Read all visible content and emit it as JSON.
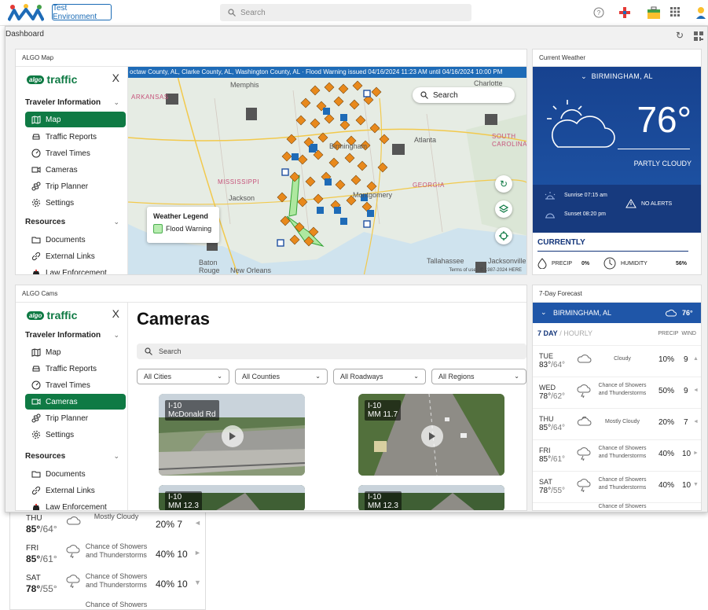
{
  "topbar": {
    "env_label": "Test Environment",
    "search_placeholder": "Search"
  },
  "dashboard": {
    "title": "Dashboard"
  },
  "sidebar": {
    "logo_badge": "algo",
    "logo_word": "traffic",
    "close": "X",
    "traveler_heading": "Traveler Information",
    "resources_heading": "Resources",
    "items": [
      {
        "label": "Map"
      },
      {
        "label": "Traffic Reports"
      },
      {
        "label": "Travel Times"
      },
      {
        "label": "Cameras"
      },
      {
        "label": "Trip Planner"
      },
      {
        "label": "Settings"
      }
    ],
    "resources": [
      {
        "label": "Documents"
      },
      {
        "label": "External Links"
      },
      {
        "label": "Law Enforcement"
      }
    ]
  },
  "map_card": {
    "title": "ALGO Map",
    "banner": "octaw County, AL, Clarke County, AL, Washington County, AL · Flood Warning issued 04/16/2024 11:23 AM until 04/16/2024 10:00 PM",
    "search_label": "Search",
    "labels": [
      "Memphis",
      "Charlotte",
      "ARKANSAS",
      "Atlanta",
      "SOUTH CAROLINA",
      "Birmingham",
      "MISSISSIPPI",
      "Jackson",
      "GEORGIA",
      "Montgomery",
      "Tallahassee",
      "Baton Rouge",
      "New Orleans",
      "Jacksonville"
    ],
    "legend_title": "Weather Legend",
    "legend_item": "Flood Warning",
    "terms": "Terms of use",
    "copyright": "© 1987-2024 HERE"
  },
  "weather_card": {
    "title": "Current Weather",
    "city": "BIRMINGHAM, AL",
    "temp": "76°",
    "condition": "PARTLY CLOUDY",
    "sunrise": "Sunrise 07:15 am",
    "sunset": "Sunset 08:20 pm",
    "alerts": "NO ALERTS",
    "currently": "CURRENTLY",
    "precip_label": "PRECIP",
    "precip_value": "0%",
    "humidity_label": "HUMIDITY",
    "humidity_value": "56%"
  },
  "cams_card": {
    "title": "ALGO Cams",
    "heading": "Cameras",
    "search_placeholder": "Search",
    "filters": [
      "All Cities",
      "All Counties",
      "All Roadways",
      "All Regions"
    ],
    "cams": [
      {
        "road": "I-10",
        "loc": "McDonald Rd"
      },
      {
        "road": "I-10",
        "loc": "MM 11.7"
      },
      {
        "road": "I-10",
        "loc": "MM 12.3"
      },
      {
        "road": "I-10",
        "loc": "MM 12.3"
      }
    ]
  },
  "forecast_card": {
    "title": "7-Day Forecast",
    "city": "BIRMINGHAM, AL",
    "temp": "76°",
    "tab_active": "7 DAY",
    "tab_sep": " / ",
    "tab_inactive": "HOURLY",
    "col_precip": "PRECIP",
    "col_wind": "WIND",
    "days": [
      {
        "day": "TUE",
        "hi": "83°",
        "lo": "/64°",
        "cond": "Cloudy",
        "precip": "10%",
        "wind": "9"
      },
      {
        "day": "WED",
        "hi": "78°",
        "lo": "/62°",
        "cond": "Chance of Showers and Thunderstorms",
        "precip": "50%",
        "wind": "9"
      },
      {
        "day": "THU",
        "hi": "85°",
        "lo": "/64°",
        "cond": "Mostly Cloudy",
        "precip": "20%",
        "wind": "7"
      },
      {
        "day": "FRI",
        "hi": "85°",
        "lo": "/61°",
        "cond": "Chance of Showers and Thunderstorms",
        "precip": "40%",
        "wind": "10"
      },
      {
        "day": "SAT",
        "hi": "78°",
        "lo": "/55°",
        "cond": "Chance of Showers and Thunderstorms",
        "precip": "40%",
        "wind": "10"
      }
    ],
    "partial_cond": "Chance of Showers"
  },
  "background_forecast": {
    "days": [
      {
        "day": "THU",
        "hi": "85°",
        "lo": "/64°",
        "cond": "Mostly Cloudy",
        "pw": "20%  7"
      },
      {
        "day": "FRI",
        "hi": "85°",
        "lo": "/61°",
        "cond": "Chance of Showers and Thunderstorms",
        "pw": "40% 10"
      },
      {
        "day": "SAT",
        "hi": "78°",
        "lo": "/55°",
        "cond": "Chance of Showers and Thunderstorms",
        "pw": "40% 10"
      }
    ],
    "partial_cond": "Chance of Showers"
  },
  "colors": {
    "brand_green": "#0f7a44",
    "weather_blue": "#1f56a8",
    "banner_blue": "#1e6bb7",
    "incident_orange": "#e8891c"
  }
}
